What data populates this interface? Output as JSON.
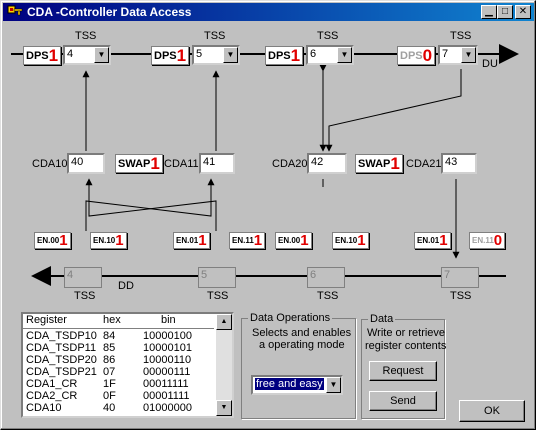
{
  "window": {
    "title": "CDA -Controller Data Access",
    "controls": [
      "minimize",
      "maximize",
      "close"
    ]
  },
  "top_bus": {
    "direction_label": "DU",
    "dps_blocks": [
      {
        "label": "DPS",
        "number": "1",
        "tss_label": "TSS",
        "tss_value": "4",
        "enabled": true
      },
      {
        "label": "DPS",
        "number": "1",
        "tss_label": "TSS",
        "tss_value": "5",
        "enabled": true
      },
      {
        "label": "DPS",
        "number": "1",
        "tss_label": "TSS",
        "tss_value": "6",
        "enabled": true
      },
      {
        "label": "DPS",
        "number": "0",
        "tss_label": "TSS",
        "tss_value": "7",
        "enabled": false
      }
    ]
  },
  "cda_registers": [
    {
      "label": "CDA10",
      "value": "40"
    },
    {
      "label": "CDA11",
      "value": "41"
    },
    {
      "label": "CDA20",
      "value": "42"
    },
    {
      "label": "CDA21",
      "value": "43"
    }
  ],
  "swap": [
    {
      "label": "SWAP",
      "number": "1"
    },
    {
      "label": "SWAP",
      "number": "1"
    }
  ],
  "enables": [
    {
      "label": "EN.00",
      "number": "1",
      "enabled": true
    },
    {
      "label": "EN.10",
      "number": "1",
      "enabled": true
    },
    {
      "label": "EN.01",
      "number": "1",
      "enabled": true
    },
    {
      "label": "EN.11",
      "number": "1",
      "enabled": true
    },
    {
      "label": "EN.00",
      "number": "1",
      "enabled": true
    },
    {
      "label": "EN.10",
      "number": "1",
      "enabled": true
    },
    {
      "label": "EN.01",
      "number": "1",
      "enabled": true
    },
    {
      "label": "EN.11",
      "number": "0",
      "enabled": false
    }
  ],
  "bottom_bus": {
    "direction_label": "DD",
    "tss": [
      {
        "label": "TSS",
        "value": "4"
      },
      {
        "label": "TSS",
        "value": "5"
      },
      {
        "label": "TSS",
        "value": "6"
      },
      {
        "label": "TSS",
        "value": "7"
      }
    ]
  },
  "register_table": {
    "headers": [
      "Register",
      "hex",
      "bin"
    ],
    "rows": [
      [
        "CDA_TSDP10",
        "84",
        "10000100"
      ],
      [
        "CDA_TSDP11",
        "85",
        "10000101"
      ],
      [
        "CDA_TSDP20",
        "86",
        "10000110"
      ],
      [
        "CDA_TSDP21",
        "07",
        "00000111"
      ],
      [
        "CDA1_CR",
        "1F",
        "00011111"
      ],
      [
        "CDA2_CR",
        "0F",
        "00001111"
      ],
      [
        "CDA10",
        "40",
        "01000000"
      ]
    ]
  },
  "data_operations": {
    "title": "Data Operations",
    "description_line1": "Selects and enables",
    "description_line2": "a operating mode",
    "mode_selected": "free and easy"
  },
  "data_group": {
    "title": "Data",
    "description_line1": "Write or retrieve",
    "description_line2": "register contents",
    "request_label": "Request",
    "send_label": "Send"
  },
  "ok_label": "OK"
}
